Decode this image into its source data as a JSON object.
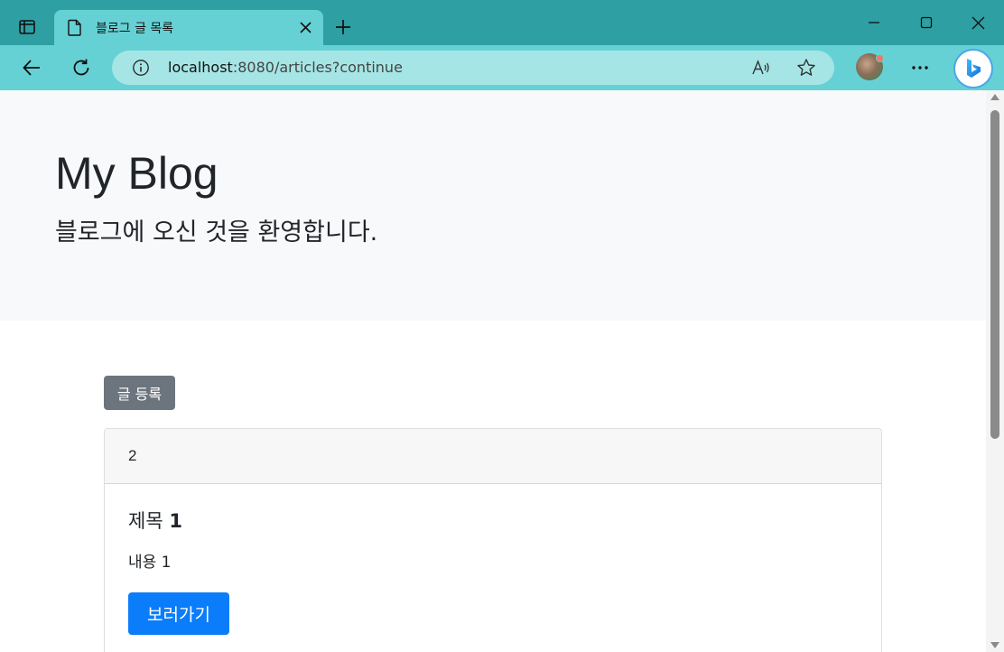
{
  "browser": {
    "tab": {
      "title": "블로그 글 목록"
    },
    "address_bar": {
      "host": "localhost",
      "path": ":8080/articles?continue"
    },
    "icons": {
      "tab_actions": "tab-actions-icon",
      "page": "page-icon",
      "close": "close-icon",
      "new_tab": "plus-icon",
      "minimize": "minimize-icon",
      "maximize": "maximize-icon",
      "window_close": "close-icon",
      "back": "back-arrow-icon",
      "refresh": "refresh-icon",
      "site_info": "info-icon",
      "read_aloud": "read-aloud-icon",
      "favorite": "star-icon",
      "more": "more-icon",
      "copilot": "bing-copilot-icon"
    },
    "colors": {
      "tabbar": "#2e9fa2",
      "toolbar": "#66d1d4",
      "address_bar": "#a6e5e5"
    }
  },
  "page": {
    "header": {
      "title": "My Blog",
      "lead": "블로그에 오신 것을 환영합니다."
    },
    "create_button": "글 등록",
    "articles": [
      {
        "id": "2",
        "title_prefix": "제목 ",
        "title_number": "1",
        "content": "내용 1",
        "view_button": "보러가기"
      }
    ],
    "colors": {
      "jumbotron_bg": "#f8f9fa",
      "secondary_button": "#6c757d",
      "primary_button": "#0b7dfb"
    }
  }
}
